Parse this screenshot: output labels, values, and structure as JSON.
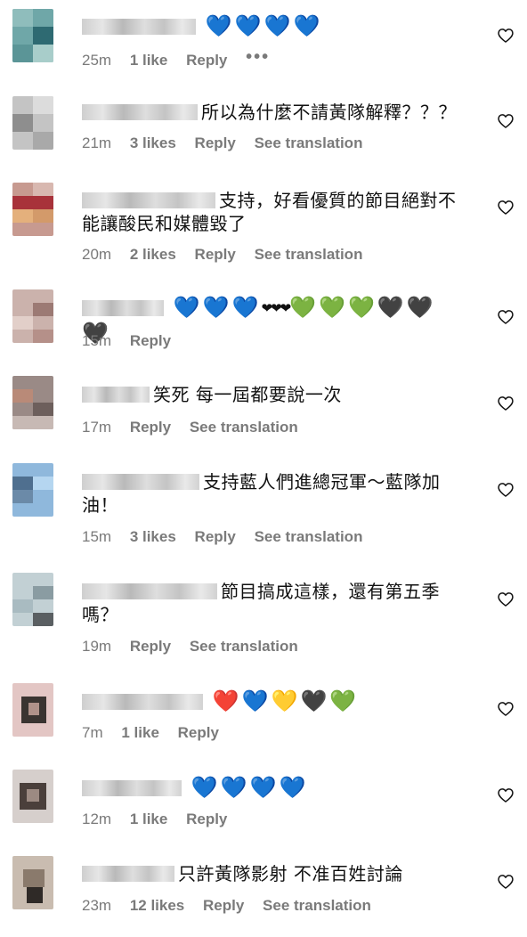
{
  "icons": {
    "like": "heart-outline-icon",
    "more": "more-dots-icon"
  },
  "comments": [
    {
      "text": "",
      "hearts": [
        "💙",
        "💙",
        "💙",
        "💙"
      ],
      "time": "25m",
      "likes": "1 like",
      "reply": "Reply",
      "more": "•••",
      "translate": ""
    },
    {
      "text": "所以為什麼不請黃隊解釋？？？",
      "hearts": [],
      "time": "21m",
      "likes": "3 likes",
      "reply": "Reply",
      "translate": "See translation"
    },
    {
      "text": "支持，好看優質的節目絕對不能讓酸民和媒體毀了",
      "hearts": [],
      "time": "20m",
      "likes": "2 likes",
      "reply": "Reply",
      "translate": "See translation"
    },
    {
      "text": "",
      "hearts": [
        "💙",
        "💙",
        "💙",
        "❤❤❤",
        "💚",
        "💚",
        "💚",
        "🖤",
        "🖤",
        "🖤"
      ],
      "time": "15m",
      "likes": "",
      "reply": "Reply",
      "translate": ""
    },
    {
      "text": "笑死 每一屆都要說一次",
      "hearts": [],
      "time": "17m",
      "likes": "",
      "reply": "Reply",
      "translate": "See translation"
    },
    {
      "text": "支持藍人們進總冠軍～藍隊加油！",
      "hearts": [],
      "time": "15m",
      "likes": "3 likes",
      "reply": "Reply",
      "translate": "See translation"
    },
    {
      "text": "節目搞成這樣，還有第五季嗎？",
      "hearts": [],
      "time": "19m",
      "likes": "",
      "reply": "Reply",
      "translate": "See translation"
    },
    {
      "text": "",
      "hearts": [
        "❤️",
        "💙",
        "💛",
        "🖤",
        "💚"
      ],
      "time": "7m",
      "likes": "1 like",
      "reply": "Reply",
      "translate": ""
    },
    {
      "text": "",
      "hearts": [
        "💙",
        "💙",
        "💙",
        "💙"
      ],
      "time": "12m",
      "likes": "1 like",
      "reply": "Reply",
      "translate": ""
    },
    {
      "text": "只許黃隊影射 不准百姓討論",
      "hearts": [],
      "time": "23m",
      "likes": "12 likes",
      "reply": "Reply",
      "translate": "See translation"
    }
  ]
}
